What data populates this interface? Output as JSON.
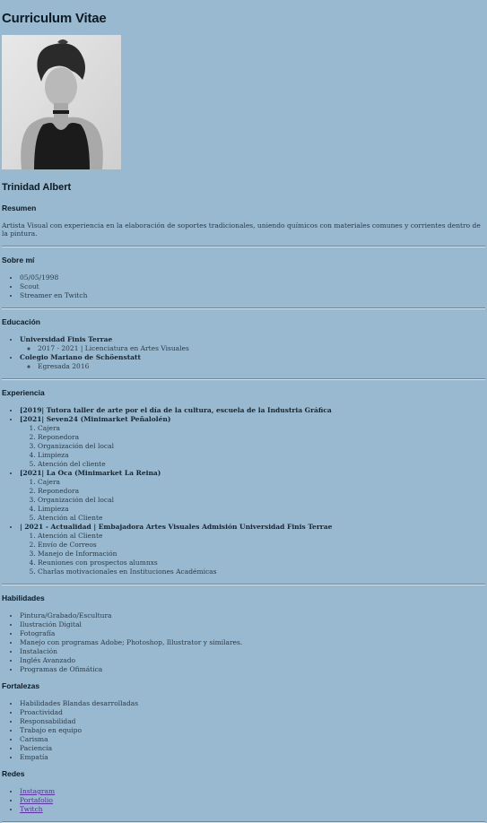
{
  "title": "Curriculum Vitae",
  "name": "Trinidad Albert",
  "summary": {
    "heading": "Resumen",
    "text": "Artista Visual con experiencia en la elaboración de soportes tradicionales, uniendo químicos con materiales comunes y corrientes dentro de la pintura."
  },
  "about": {
    "heading": "Sobre mí",
    "items": [
      "05/05/1998",
      "Scout",
      "Streamer en Twitch"
    ]
  },
  "education": {
    "heading": "Educación",
    "items": [
      {
        "school": "Universidad Finis Terrae",
        "detail": "2017 - 2021 | Licenciatura en Artes Visuales"
      },
      {
        "school": "Colegio Mariano de Schöenstatt",
        "detail": "Egresada 2016"
      }
    ]
  },
  "experience": {
    "heading": "Experiencia",
    "items": [
      {
        "title": "[2019| Tutora taller de arte por el día de la cultura, escuela de la Industria Gráfica",
        "tasks": []
      },
      {
        "title": "[2021| Seven24 (Minimarket Peñalolén)",
        "tasks": [
          "Cajera",
          "Reponedora",
          "Organización del local",
          "Limpieza",
          "Atención del cliente"
        ]
      },
      {
        "title": "[2021| La Oca (Minimarket La Reina)",
        "tasks": [
          "Cajera",
          "Reponedora",
          "Organización del local",
          "Limpieza",
          "Atención al Cliente"
        ]
      },
      {
        "title": "| 2021 - Actualidad | Embajadora Artes Visuales Admisión Universidad Finis Terrae",
        "tasks": [
          "Atención al Cliente",
          "Envío de Correos",
          "Manejo de Información",
          "Reuniones con prospectos alumnxs",
          "Charlas motivacionales en Instituciones Académicas"
        ]
      }
    ]
  },
  "skills": {
    "heading": "Habilidades",
    "items": [
      "Pintura/Grabado/Escultura",
      "Ilustración Digital",
      "Fotografía",
      "Manejo con programas Adobe; Photoshop, Illustrator y similares.",
      "Instalación",
      "Inglés Avanzado",
      "Programas de Ofimática"
    ]
  },
  "strengths": {
    "heading": "Fortalezas",
    "items": [
      "Habilidades Blandas desarrolladas",
      "Proactividad",
      "Responsabilidad",
      "Trabajo en equipo",
      "Carisma",
      "Paciencia",
      "Empatía"
    ]
  },
  "social": {
    "heading": "Redes",
    "links": [
      "Instagram",
      "Portafolio",
      "Twitch"
    ]
  },
  "photo_icon": "portrait-photo"
}
